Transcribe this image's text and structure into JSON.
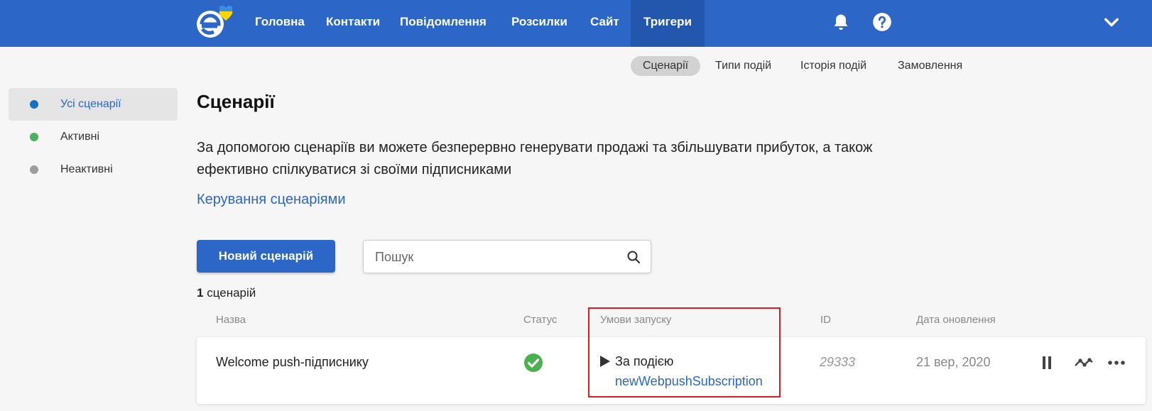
{
  "topbar": {
    "nav": [
      {
        "label": "Головна"
      },
      {
        "label": "Контакти"
      },
      {
        "label": "Повідомлення"
      },
      {
        "label": "Розсилки"
      },
      {
        "label": "Сайт"
      },
      {
        "label": "Тригери",
        "active": true
      }
    ],
    "icons": [
      "bell-icon",
      "help-icon",
      "chevron-down-icon"
    ],
    "colors": {
      "bar": "#2c66c6",
      "active": "#2356ad"
    }
  },
  "subnav": [
    {
      "label": "Сценарії",
      "active": true
    },
    {
      "label": "Типи подій"
    },
    {
      "label": "Історія подій"
    },
    {
      "label": "Замовлення"
    }
  ],
  "sidebar": [
    {
      "label": "Усі сценарії",
      "color": "#1b6fc0",
      "active": true
    },
    {
      "label": "Активні",
      "color": "#4caf62"
    },
    {
      "label": "Неактивні",
      "color": "#9e9e9e"
    }
  ],
  "main": {
    "title": "Сценарії",
    "description": "За допомогою сценаріїв ви можете безперервно генерувати продажі та збільшувати прибуток, а також ефективно спілкуватися зі своїми підписниками",
    "manage_link": "Керування сценаріями",
    "new_button": "Новий сценарій",
    "search_placeholder": "Пошук",
    "count_number": "1",
    "count_label": "сценарій"
  },
  "table": {
    "columns": [
      "Назва",
      "Статус",
      "Умови запуску",
      "ID",
      "Дата оновлення"
    ],
    "rows": [
      {
        "name": "Welcome push-підписнику",
        "status": "active",
        "trigger_label": "За подією",
        "trigger_event": "newWebpushSubscription",
        "id": "29333",
        "date": "21 вер, 2020"
      }
    ]
  },
  "colors": {
    "accent": "#2c66c6",
    "success": "#4caf50",
    "highlight": "#e01b24"
  }
}
